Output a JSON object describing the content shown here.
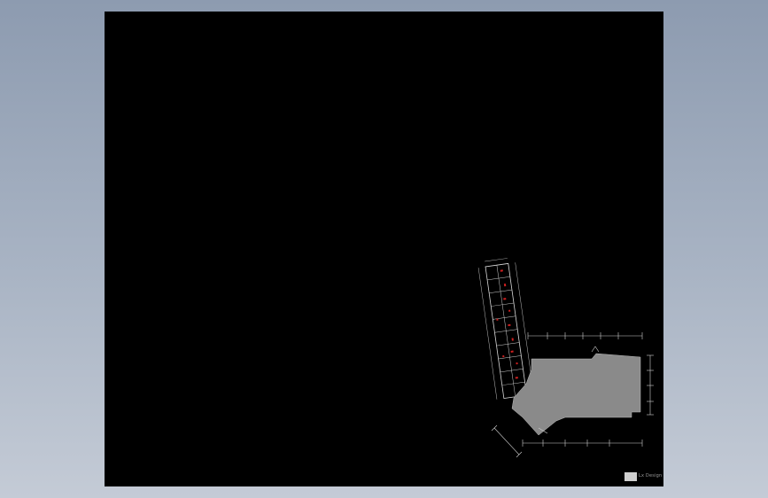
{
  "viewer": {
    "background_top": "#8d9bb0",
    "background_bottom": "#c4cbd6",
    "sheet_color": "#000000"
  },
  "drawing": {
    "wall_color": "#8a8a8a",
    "line_color": "#d8d8d8",
    "annotation_color": "#d02020"
  },
  "title_block": {
    "logo": "company-logo-icon",
    "text": "Lx Design"
  }
}
